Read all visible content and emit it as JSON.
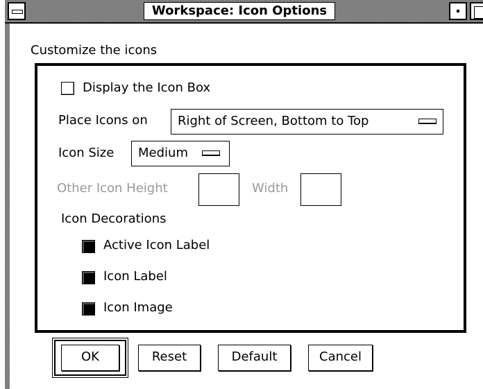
{
  "window": {
    "title": "Workspace: Icon Options"
  },
  "main": {
    "heading": "Customize the icons",
    "display_icon_box": {
      "label": "Display the Icon Box",
      "checked": false
    },
    "place_icons": {
      "label": "Place Icons on",
      "value": "Right of Screen, Bottom to Top"
    },
    "icon_size": {
      "label": "Icon Size",
      "value": "Medium"
    },
    "other_height": {
      "label": "Other Icon Height",
      "value": "",
      "disabled": true
    },
    "width": {
      "label": "Width",
      "value": "",
      "disabled": true
    },
    "decorations": {
      "label": "Icon Decorations",
      "items": [
        {
          "label": "Active Icon Label",
          "checked": true
        },
        {
          "label": "Icon Label",
          "checked": true
        },
        {
          "label": "Icon Image",
          "checked": true
        }
      ]
    }
  },
  "buttons": {
    "ok": "OK",
    "reset": "Reset",
    "default": "Default",
    "cancel": "Cancel"
  },
  "colors": {
    "frame": "#000000",
    "background": "#ffffff",
    "disabled_text": "#999999"
  }
}
